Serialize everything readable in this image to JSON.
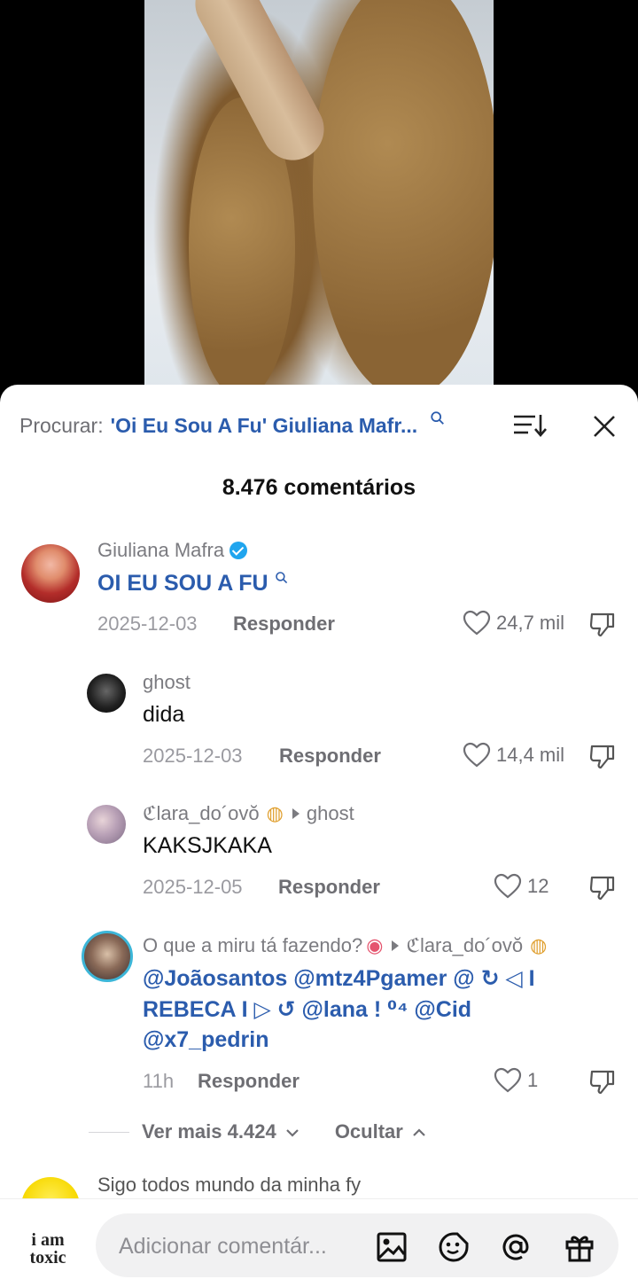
{
  "search": {
    "prefix": "Procurar:",
    "query": "'Oi Eu Sou A Fu' Giuliana Mafr..."
  },
  "comments_count": "8.476 comentários",
  "comments": [
    {
      "user": "Giuliana Mafra",
      "text": "OI EU SOU A FU",
      "date": "2025-12-03",
      "reply": "Responder",
      "likes": "24,7 mil"
    },
    {
      "user": "ghost",
      "text": "dida",
      "date": "2025-12-03",
      "reply": "Responder",
      "likes": "14,4 mil"
    },
    {
      "user": "ℭlara_do´ovŏ",
      "reply_to": "ghost",
      "text": "KAKSJKAKA",
      "date": "2025-12-05",
      "reply": "Responder",
      "likes": "12"
    },
    {
      "user": "O que a miru tá fazendo?",
      "reply_to": "ℭlara_do´ovŏ",
      "line1": "@Joãosantos @mtz4Pgamer @ ↻ ◁ I",
      "line2": "REBECA I ▷ ↺ @lana ! ⁰⁴ @Cid",
      "line3": "@x7_pedrin",
      "date": "11h",
      "reply": "Responder",
      "likes": "1"
    }
  ],
  "more": {
    "view_more": "Ver mais 4.424",
    "hide": "Ocultar"
  },
  "next_comment": {
    "text": "Sigo todos mundo da minha fy"
  },
  "composer": {
    "placeholder": "Adicionar comentár...",
    "my_avatar_text": "i am toxic"
  }
}
